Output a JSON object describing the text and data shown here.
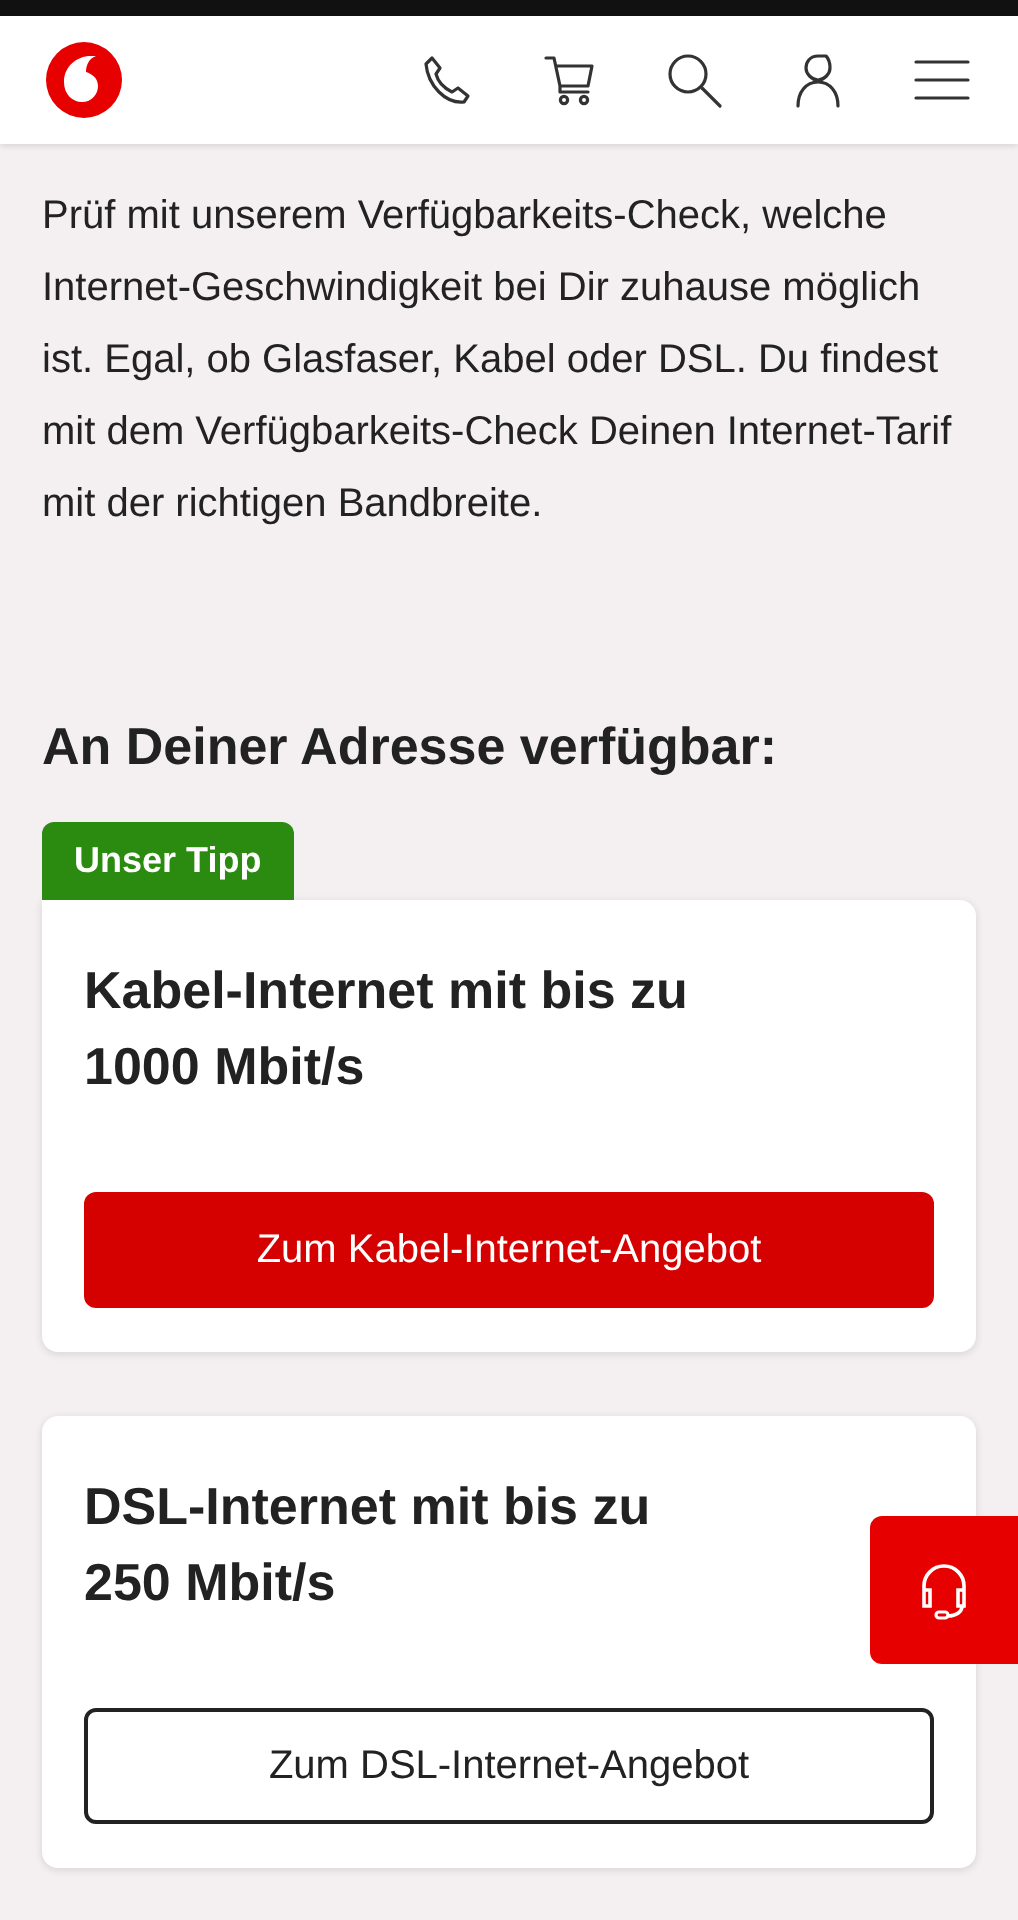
{
  "intro": "Prüf mit unserem Verfügbarkeits-Check, welche Internet-Geschwindigkeit bei Dir zuhause möglich ist.  Egal, ob Glasfaser, Kabel oder DSL. Du findest mit dem Verfügbarkeits-Check Deinen Internet-Tarif mit der richtigen Bandbreite.",
  "heading": "An Deiner Adresse verfügbar:",
  "offers": [
    {
      "badge": "Unser Tipp",
      "title_lines": [
        "Kabel-Internet mit bis zu",
        "1000 Mbit/s"
      ],
      "button": "Zum Kabel-Internet-Angebot",
      "kind": "primary"
    },
    {
      "title_lines": [
        "DSL-Internet mit bis zu",
        "250 Mbit/s"
      ],
      "button": "Zum DSL-Internet-Angebot",
      "kind": "secondary"
    }
  ]
}
